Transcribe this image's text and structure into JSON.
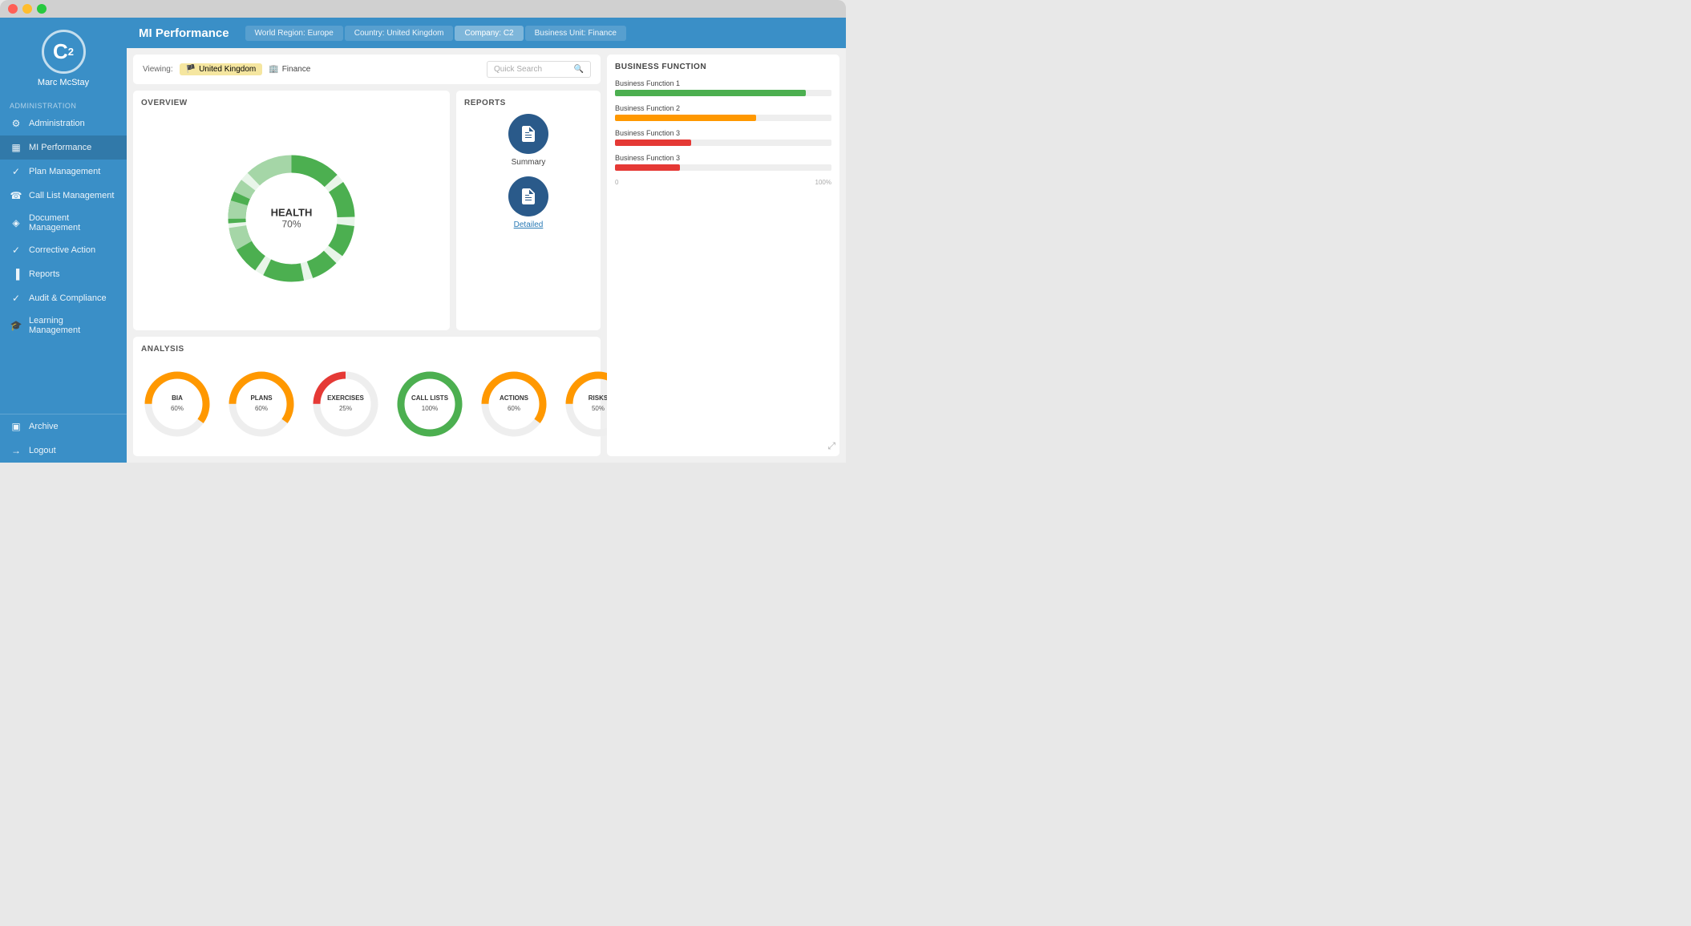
{
  "window": {
    "title": "MI Performance"
  },
  "sidebar": {
    "logo": "C²",
    "username": "Marc McStay",
    "section_label": "Administration",
    "items": [
      {
        "id": "administration",
        "label": "Administration",
        "icon": "⚙"
      },
      {
        "id": "mi-performance",
        "label": "MI Performance",
        "icon": "▦",
        "active": true
      },
      {
        "id": "plan-management",
        "label": "Plan Management",
        "icon": "✓"
      },
      {
        "id": "call-list",
        "label": "Call List Management",
        "icon": "☎"
      },
      {
        "id": "document",
        "label": "Document Management",
        "icon": "◈"
      },
      {
        "id": "corrective-action",
        "label": "Corrective Action",
        "icon": "✓"
      },
      {
        "id": "reports",
        "label": "Reports",
        "icon": "▐"
      },
      {
        "id": "audit",
        "label": "Audit & Compliance",
        "icon": "✓"
      },
      {
        "id": "learning",
        "label": "Learning Management",
        "icon": "🎓"
      }
    ],
    "bottom_items": [
      {
        "id": "archive",
        "label": "Archive",
        "icon": "▣"
      },
      {
        "id": "logout",
        "label": "Logout",
        "icon": "→"
      }
    ]
  },
  "topbar": {
    "title": "MI Performance",
    "breadcrumbs": [
      {
        "label": "World Region: Europe"
      },
      {
        "label": "Country: United Kingdom"
      },
      {
        "label": "Company: C2",
        "active": true
      },
      {
        "label": "Business Unit: Finance"
      }
    ]
  },
  "viewing": {
    "label": "Viewing:",
    "tags": [
      "United Kingdom",
      "Finance"
    ],
    "search_placeholder": "Quick Search"
  },
  "overview": {
    "title": "OVERVIEW",
    "health_label": "HEALTH",
    "health_pct": "70%"
  },
  "reports": {
    "title": "REPORTS",
    "items": [
      {
        "label": "Summary"
      },
      {
        "label": "Detailed"
      }
    ]
  },
  "business_function": {
    "title": "BUSINESS FUNCTION",
    "items": [
      {
        "name": "Business Function 1",
        "pct": 88,
        "color": "#4caf50"
      },
      {
        "name": "Business Function 2",
        "pct": 65,
        "color": "#ff9800"
      },
      {
        "name": "Business Function 3",
        "pct": 35,
        "color": "#e53935"
      },
      {
        "name": "Business Function 3",
        "pct": 30,
        "color": "#e53935"
      }
    ],
    "axis_start": "0",
    "axis_end": "100%"
  },
  "analysis": {
    "title": "ANALYSIS",
    "charts": [
      {
        "label": "BIA",
        "pct": 60,
        "pct_label": "60%",
        "color": "#ff9800"
      },
      {
        "label": "PLANS",
        "pct": 60,
        "pct_label": "60%",
        "color": "#ff9800"
      },
      {
        "label": "EXERCISES",
        "pct": 25,
        "pct_label": "25%",
        "color": "#e53935"
      },
      {
        "label": "CALL LISTS",
        "pct": 100,
        "pct_label": "100%",
        "color": "#4caf50"
      },
      {
        "label": "ACTIONS",
        "pct": 60,
        "pct_label": "60%",
        "color": "#ff9800"
      },
      {
        "label": "RISKS",
        "pct": 50,
        "pct_label": "50%",
        "color": "#ff9800"
      }
    ]
  }
}
